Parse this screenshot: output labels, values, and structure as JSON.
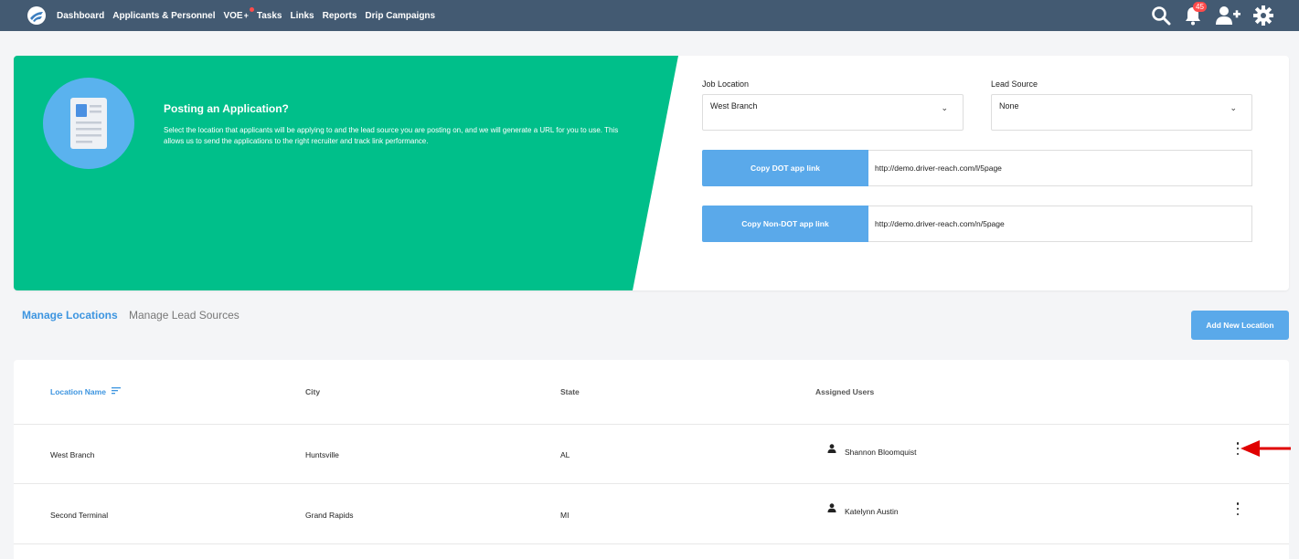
{
  "nav": {
    "items": [
      "Dashboard",
      "Applicants & Personnel",
      "VOE",
      "Tasks",
      "Links",
      "Reports",
      "Drip Campaigns"
    ],
    "voe_plus": "+",
    "notification_count": "45"
  },
  "banner": {
    "title": "Posting an Application?",
    "description": "Select the location that applicants will be applying to and the lead source you are posting on, and we will generate a URL for you to use. This allows us to send the applications to the right recruiter and track link performance.",
    "job_location_label": "Job Location",
    "job_location_value": "West Branch",
    "lead_source_label": "Lead Source",
    "lead_source_value": "None",
    "copy_dot_label": "Copy DOT app link",
    "dot_url": "http://demo.driver-reach.com/l/5page",
    "copy_non_dot_label": "Copy Non-DOT app link",
    "non_dot_url": "http://demo.driver-reach.com/n/5page"
  },
  "tabs": {
    "manage_locations": "Manage Locations",
    "manage_lead_sources": "Manage Lead Sources"
  },
  "add_location_label": "Add New Location",
  "table": {
    "headers": {
      "location": "Location Name",
      "city": "City",
      "state": "State",
      "users": "Assigned Users"
    },
    "rows": [
      {
        "location": "West Branch",
        "city": "Huntsville",
        "state": "AL",
        "user": "Shannon Bloomquist"
      },
      {
        "location": "Second Terminal",
        "city": "Grand Rapids",
        "state": "MI",
        "user": "Katelynn Austin"
      }
    ]
  },
  "colors": {
    "nav_bg": "#435a72",
    "banner_green": "#00bf8a",
    "accent_blue": "#5aa9ea",
    "annotation_red": "#e00000"
  }
}
